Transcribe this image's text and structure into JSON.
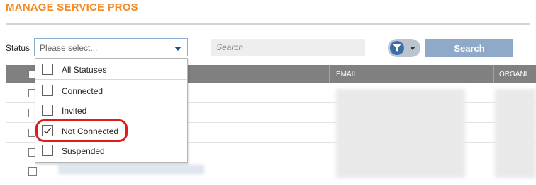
{
  "header": {
    "title": "MANAGE SERVICE PROS"
  },
  "filters": {
    "status_label": "Status",
    "status_placeholder": "Please select...",
    "search_placeholder": "Search",
    "search_button": "Search"
  },
  "status_dropdown": {
    "options": [
      {
        "label": "All Statuses",
        "checked": false
      },
      {
        "label": "Connected",
        "checked": false
      },
      {
        "label": "Invited",
        "checked": false
      },
      {
        "label": "Not Connected",
        "checked": true
      },
      {
        "label": "Suspended",
        "checked": false
      }
    ]
  },
  "table": {
    "columns": [
      "EMAIL",
      "ORGANI"
    ]
  },
  "colors": {
    "title": "#f08a24",
    "header_bg": "#808080",
    "search_button": "#8fa9c9",
    "annotation": "#e01b1b"
  },
  "icons": {
    "filter": "funnel-icon",
    "dropdown_caret": "chevron-down-icon",
    "check": "check-icon"
  }
}
